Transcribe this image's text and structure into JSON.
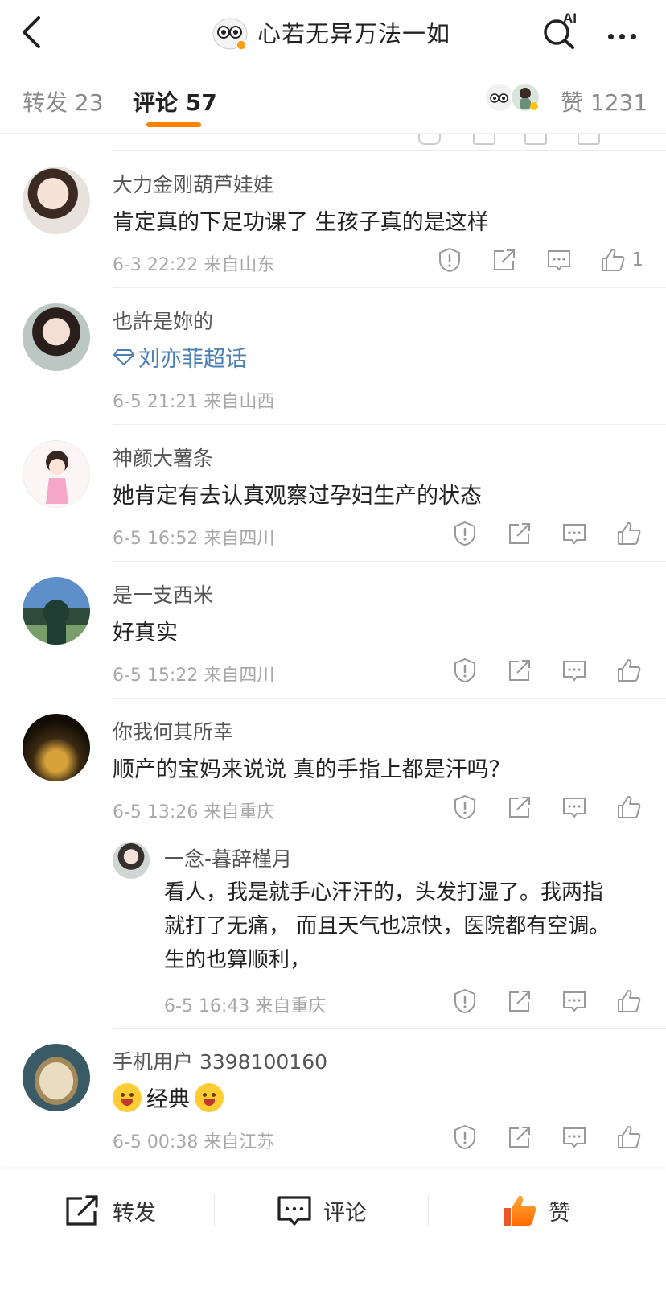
{
  "header": {
    "title": "心若无异万法一如",
    "ai_label": "AI"
  },
  "tabs": {
    "forward": "转发 23",
    "comment": "评论 57",
    "like": "赞 1231"
  },
  "colors": {
    "accent": "#ff8200",
    "topic": "#4a7fb5",
    "meta": "#a8a8a8"
  },
  "comments": [
    {
      "name": "大力金刚葫芦娃娃",
      "body": "肯定真的下足功课了 生孩子真的是这样",
      "meta": "6-3 22:22 来自山东",
      "likes": "1"
    },
    {
      "name": "也許是妳的",
      "body": "刘亦菲超话",
      "meta": "6-5 21:21 来自山西"
    },
    {
      "name": "神颜大薯条",
      "body": "她肯定有去认真观察过孕妇生产的状态",
      "meta": "6-5 16:52 来自四川"
    },
    {
      "name": "是一支西米",
      "body": "好真实",
      "meta": "6-5 15:22 来自四川"
    },
    {
      "name": "你我何其所幸",
      "body": "顺产的宝妈来说说 真的手指上都是汗吗？",
      "meta": "6-5 13:26 来自重庆",
      "reply": {
        "name": "一念-暮辞槿月",
        "body": "看人，我是就手心汗汗的，头发打湿了。我两指就打了无痛， 而且天气也凉快，医院都有空调。生的也算顺利，",
        "meta": "6-5 16:43 来自重庆"
      }
    },
    {
      "name": "手机用户 3398100160",
      "body": "经典",
      "meta": "6-5 00:38 来自江苏"
    }
  ],
  "bottom": {
    "forward": "转发",
    "comment": "评论",
    "like": "赞"
  }
}
